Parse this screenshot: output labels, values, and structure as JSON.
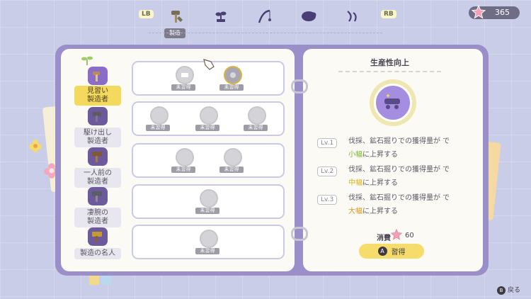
{
  "header": {
    "lb_label": "LB",
    "rb_label": "RB",
    "active_tab_label": "製造",
    "tabs": [
      {
        "icon": "hammer-icon",
        "active": true
      },
      {
        "icon": "sprout-icon",
        "active": false
      },
      {
        "icon": "fishing-rod-icon",
        "active": false
      },
      {
        "icon": "sheep-icon",
        "active": false
      },
      {
        "icon": "bug-net-icon",
        "active": false
      }
    ],
    "points": "365"
  },
  "tiers": [
    {
      "label": "見習い\n製造者",
      "locked": false,
      "active": true
    },
    {
      "label": "駆け出し\n製造者",
      "locked": true,
      "active": false
    },
    {
      "label": "一人前の\n製造者",
      "locked": true,
      "active": false
    },
    {
      "label": "凄腕の\n製造者",
      "locked": true,
      "active": false
    },
    {
      "label": "製造の名人",
      "locked": true,
      "active": false
    }
  ],
  "skill_rows": [
    {
      "skills": [
        {
          "status": "未習得"
        },
        {
          "status": "未習得",
          "selected": true
        }
      ]
    },
    {
      "skills": [
        {
          "status": "未習得"
        },
        {
          "status": "未習得"
        },
        {
          "status": "未習得"
        }
      ]
    },
    {
      "skills": [
        {
          "status": "未習得"
        },
        {
          "status": "未習得"
        }
      ]
    },
    {
      "skills": [
        {
          "status": "未習得"
        }
      ]
    },
    {
      "skills": [
        {
          "status": "未習得"
        }
      ]
    }
  ],
  "detail": {
    "title": "生産性向上",
    "levels": [
      {
        "lv": "Lv.1",
        "line1": "伐採、鉱石掘りでの獲得量が で",
        "hl": "小幅",
        "line2": "に上昇する",
        "hl_color": "#79b52e"
      },
      {
        "lv": "Lv.2",
        "line1": "伐採、鉱石掘りでの獲得量が で",
        "hl": "中幅",
        "line2": "に上昇する",
        "hl_color": "#d6b414"
      },
      {
        "lv": "Lv.3",
        "line1": "伐採、鉱石掘りでの獲得量が で",
        "hl": "大幅",
        "line2": "に上昇する",
        "hl_color": "#d89a1e"
      }
    ],
    "cost_label": "消費",
    "cost_value": "60",
    "learn_button_key": "A",
    "learn_button_label": "習得"
  },
  "footer": {
    "back_key": "B",
    "back_label": "戻る"
  }
}
